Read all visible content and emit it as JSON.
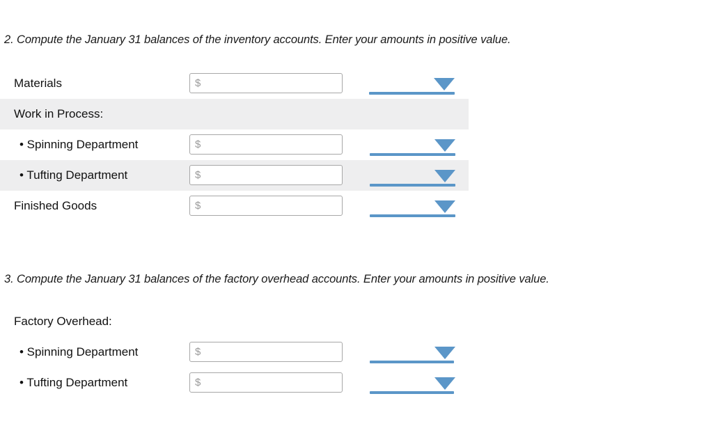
{
  "sections": [
    {
      "id": "inventory",
      "prompt": "2. Compute the January 31 balances of the inventory accounts. Enter your amounts in positive value.",
      "rows": [
        {
          "label": "Materials",
          "indent": false,
          "shaded": false,
          "has_input": true,
          "placeholder": "$",
          "value": "",
          "has_dropdown": true,
          "dropdown_value": ""
        },
        {
          "label": "Work in Process:",
          "indent": false,
          "shaded": true,
          "has_input": false,
          "placeholder": "",
          "value": "",
          "has_dropdown": false,
          "dropdown_value": ""
        },
        {
          "label": "• Spinning Department",
          "indent": true,
          "shaded": false,
          "has_input": true,
          "placeholder": "$",
          "value": "",
          "has_dropdown": true,
          "dropdown_value": ""
        },
        {
          "label": "• Tufting Department",
          "indent": true,
          "shaded": true,
          "has_input": true,
          "placeholder": "$",
          "value": "",
          "has_dropdown": true,
          "dropdown_value": ""
        },
        {
          "label": "Finished Goods",
          "indent": false,
          "shaded": false,
          "has_input": true,
          "placeholder": "$",
          "value": "",
          "has_dropdown": true,
          "dropdown_value": ""
        }
      ]
    },
    {
      "id": "overhead",
      "prompt": "3. Compute the January 31 balances of the factory overhead accounts. Enter your amounts in positive value.",
      "rows": [
        {
          "label": "Factory Overhead:",
          "indent": false,
          "shaded": false,
          "has_input": false,
          "placeholder": "",
          "value": "",
          "has_dropdown": false,
          "dropdown_value": ""
        },
        {
          "label": "• Spinning Department",
          "indent": true,
          "shaded": false,
          "has_input": true,
          "placeholder": "$",
          "value": "",
          "has_dropdown": true,
          "dropdown_value": ""
        },
        {
          "label": "• Tufting Department",
          "indent": true,
          "shaded": false,
          "has_input": true,
          "placeholder": "$",
          "value": "",
          "has_dropdown": true,
          "dropdown_value": ""
        }
      ]
    }
  ],
  "icons": {
    "dropdown_caret": "chevron-down-icon"
  },
  "colors": {
    "accent_blue": "#5b96c8",
    "row_shade": "#eeeeef",
    "input_border": "#a7a7a7",
    "placeholder_gray": "#9b9b9b",
    "text": "#111111"
  }
}
